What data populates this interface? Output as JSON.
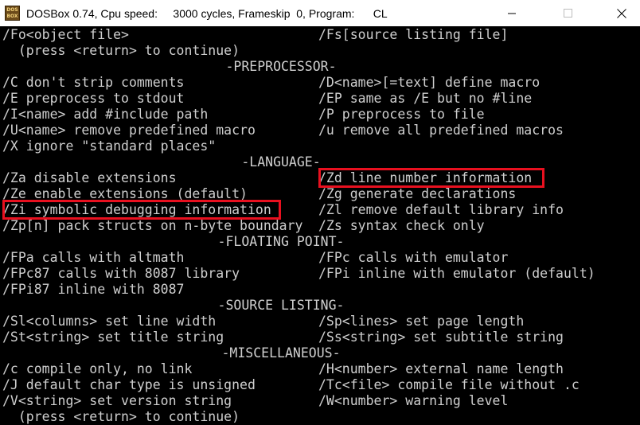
{
  "window": {
    "icon_text": "DOS BOX",
    "title": "DOSBox 0.74, Cpu speed:     3000 cycles, Frameskip  0, Program:      CL",
    "buttons": {
      "minimize": "minimize-icon",
      "maximize": "maximize-icon",
      "close": "close-icon"
    }
  },
  "console": {
    "lines": [
      {
        "left": "/Fo<object file>",
        "right": "/Fs[source listing file]"
      },
      {
        "left": "  (press <return> to continue)"
      },
      {
        "center": "-PREPROCESSOR-"
      },
      {
        "left": "/C don't strip comments",
        "right": "/D<name>[=text] define macro"
      },
      {
        "left": "/E preprocess to stdout",
        "right": "/EP same as /E but no #line"
      },
      {
        "left": "/I<name> add #include path",
        "right": "/P preprocess to file"
      },
      {
        "left": "/U<name> remove predefined macro",
        "right": "/u remove all predefined macros"
      },
      {
        "left": "/X ignore \"standard places\""
      },
      {
        "center": "-LANGUAGE-"
      },
      {
        "left": "/Za disable extensions",
        "right": "/Zd line number information"
      },
      {
        "left": "/Ze enable extensions (default)",
        "right": "/Zg generate declarations"
      },
      {
        "left": "/Zi symbolic debugging information",
        "right": "/Zl remove default library info"
      },
      {
        "left": "/Zp[n] pack structs on n-byte boundary",
        "right": "/Zs syntax check only"
      },
      {
        "center": "-FLOATING POINT-"
      },
      {
        "left": "/FPa calls with altmath",
        "right": "/FPc calls with emulator"
      },
      {
        "left": "/FPc87 calls with 8087 library",
        "right": "/FPi inline with emulator (default)"
      },
      {
        "left": "/FPi87 inline with 8087"
      },
      {
        "center": "-SOURCE LISTING-"
      },
      {
        "left": "/Sl<columns> set line width",
        "right": "/Sp<lines> set page length"
      },
      {
        "left": "/St<string> set title string",
        "right": "/Ss<string> set subtitle string"
      },
      {
        "center": "-MISCELLANEOUS-"
      },
      {
        "left": "/c compile only, no link",
        "right": "/H<number> external name length"
      },
      {
        "left": "/J default char type is unsigned",
        "right": "/Tc<file> compile file without .c"
      },
      {
        "left": "/V<string> set version string",
        "right": "/W<number> warning level"
      },
      {
        "left": "  (press <return> to continue)"
      }
    ]
  },
  "highlights": [
    {
      "label": "/Zd line number information",
      "color": "#e8101f"
    },
    {
      "label": "/Zi symbolic debugging information",
      "color": "#e8101f"
    }
  ],
  "colors": {
    "text": "#cfcfcf",
    "background": "#000000",
    "highlight": "#e8101f"
  }
}
